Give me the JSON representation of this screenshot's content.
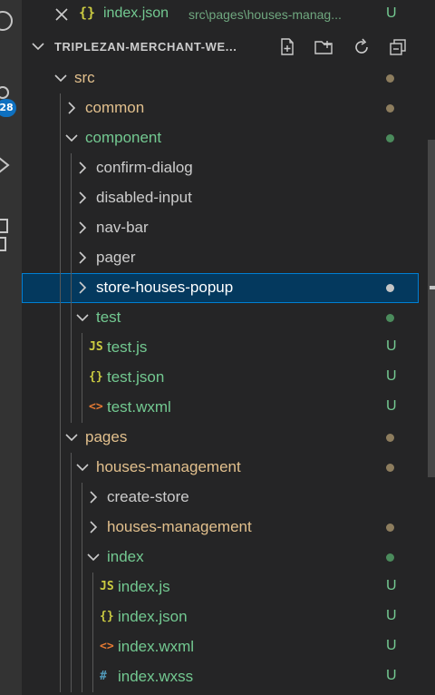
{
  "open_editor": {
    "icon_text": "{}",
    "name": "index.json",
    "path": "src\\pages\\houses-manag...",
    "status": "U"
  },
  "explorer": {
    "title": "TRIPLEZAN-MERCHANT-WE...",
    "actions": [
      "new-file-icon",
      "new-folder-icon",
      "refresh-icon",
      "collapse-all-icon"
    ]
  },
  "activity": {
    "badge": "28"
  },
  "tree": [
    {
      "label": "src",
      "kind": "folder",
      "expanded": true,
      "depth": 0,
      "decoration": "dot",
      "deco_color": "#8d7d5e",
      "label_color": "#e2c08d"
    },
    {
      "label": "common",
      "kind": "folder",
      "expanded": false,
      "depth": 1,
      "decoration": "dot",
      "deco_color": "#8d7d5e",
      "label_color": "#e2c08d"
    },
    {
      "label": "component",
      "kind": "folder",
      "expanded": true,
      "depth": 1,
      "decoration": "dot",
      "deco_color": "#4b8b5c",
      "label_color": "#73c991"
    },
    {
      "label": "confirm-dialog",
      "kind": "folder",
      "expanded": false,
      "depth": 2,
      "decoration": "none",
      "label_color": "#cccccc"
    },
    {
      "label": "disabled-input",
      "kind": "folder",
      "expanded": false,
      "depth": 2,
      "decoration": "none",
      "label_color": "#cccccc"
    },
    {
      "label": "nav-bar",
      "kind": "folder",
      "expanded": false,
      "depth": 2,
      "decoration": "none",
      "label_color": "#cccccc"
    },
    {
      "label": "pager",
      "kind": "folder",
      "expanded": false,
      "depth": 2,
      "decoration": "none",
      "label_color": "#cccccc"
    },
    {
      "label": "store-houses-popup",
      "kind": "folder",
      "expanded": false,
      "depth": 2,
      "decoration": "dot",
      "deco_color": "#c5c5c5",
      "label_color": "#ffffff",
      "selected": true
    },
    {
      "label": "test",
      "kind": "folder",
      "expanded": true,
      "depth": 2,
      "decoration": "dot",
      "deco_color": "#4b8b5c",
      "label_color": "#73c991"
    },
    {
      "label": "test.js",
      "kind": "file",
      "file_icon": "js-icon",
      "icon_text": "JS",
      "icon_color": "#cbcb41",
      "depth": 3,
      "decoration": "U",
      "label_color": "#73c991"
    },
    {
      "label": "test.json",
      "kind": "file",
      "file_icon": "json-icon",
      "icon_text": "{}",
      "icon_color": "#cbcb41",
      "depth": 3,
      "decoration": "U",
      "label_color": "#73c991"
    },
    {
      "label": "test.wxml",
      "kind": "file",
      "file_icon": "markup-icon",
      "icon_text": "<>",
      "icon_color": "#e37933",
      "depth": 3,
      "decoration": "U",
      "label_color": "#73c991"
    },
    {
      "label": "pages",
      "kind": "folder",
      "expanded": true,
      "depth": 1,
      "decoration": "dot",
      "deco_color": "#8d7d5e",
      "label_color": "#e2c08d"
    },
    {
      "label": "houses-management",
      "kind": "folder",
      "expanded": true,
      "depth": 2,
      "decoration": "dot",
      "deco_color": "#8d7d5e",
      "label_color": "#e2c08d"
    },
    {
      "label": "create-store",
      "kind": "folder",
      "expanded": false,
      "depth": 3,
      "decoration": "none",
      "label_color": "#cccccc"
    },
    {
      "label": "houses-management",
      "kind": "folder",
      "expanded": false,
      "depth": 3,
      "decoration": "dot",
      "deco_color": "#8d7d5e",
      "label_color": "#e2c08d"
    },
    {
      "label": "index",
      "kind": "folder",
      "expanded": true,
      "depth": 3,
      "decoration": "dot",
      "deco_color": "#4b8b5c",
      "label_color": "#73c991"
    },
    {
      "label": "index.js",
      "kind": "file",
      "file_icon": "js-icon",
      "icon_text": "JS",
      "icon_color": "#cbcb41",
      "depth": 4,
      "decoration": "U",
      "label_color": "#73c991"
    },
    {
      "label": "index.json",
      "kind": "file",
      "file_icon": "json-icon",
      "icon_text": "{}",
      "icon_color": "#cbcb41",
      "depth": 4,
      "decoration": "U",
      "label_color": "#73c991"
    },
    {
      "label": "index.wxml",
      "kind": "file",
      "file_icon": "markup-icon",
      "icon_text": "<>",
      "icon_color": "#e37933",
      "depth": 4,
      "decoration": "U",
      "label_color": "#73c991"
    },
    {
      "label": "index.wxss",
      "kind": "file",
      "file_icon": "css-icon",
      "icon_text": "#",
      "icon_color": "#519aba",
      "depth": 4,
      "decoration": "U",
      "label_color": "#73c991"
    }
  ]
}
